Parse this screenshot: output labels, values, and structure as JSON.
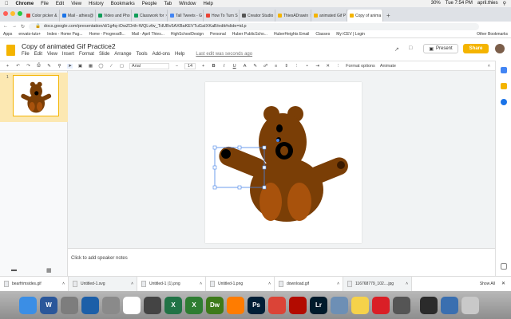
{
  "mac_menu": {
    "app": "Chrome",
    "items": [
      "File",
      "Edit",
      "View",
      "History",
      "Bookmarks",
      "People",
      "Tab",
      "Window",
      "Help"
    ],
    "battery": "30%",
    "clock": "Tue 7:54 PM",
    "user": "april.thies"
  },
  "tabs": [
    {
      "label": "Color picker & ",
      "color": "#ea4335"
    },
    {
      "label": "Mail - athies@",
      "color": "#1a73e8"
    },
    {
      "label": "Video and Pho",
      "color": "#0f9d58"
    },
    {
      "label": "Classwork for",
      "color": "#0f9d58"
    },
    {
      "label": "Tall Tweets - G",
      "color": "#4285f4"
    },
    {
      "label": "How To Turn S",
      "color": "#ea4335"
    },
    {
      "label": "Creator Studio",
      "color": "#555555"
    },
    {
      "label": "ThiesADrawin",
      "color": "#f4b400"
    },
    {
      "label": "animated Gif P",
      "color": "#f4b400"
    },
    {
      "label": "Copy of anima",
      "color": "#f4b400",
      "active": true
    }
  ],
  "address": {
    "url": "docs.google.com/presentation/d/1g4q-iOwZOrth-WQLvfw_TdUBv5AXBaKEVTuGaIXKaB/edit#slide=id.p"
  },
  "bookmarks": [
    "Apps",
    "envato-tuts+",
    "Index - Home Pag...",
    "Home - ProgressB...",
    "Mail - April Thies...",
    "HighSchoolDesign",
    "Personal",
    "Huber PublicScho...",
    "HuberHeights Email",
    "Classes",
    "My iCEV | Login",
    "Other Bookmarks"
  ],
  "docs": {
    "title": "Copy of animated Gif Practice2",
    "menus": [
      "File",
      "Edit",
      "View",
      "Insert",
      "Format",
      "Slide",
      "Arrange",
      "Tools",
      "Add-ons",
      "Help"
    ],
    "last_edit": "Last edit was seconds ago",
    "present_label": "Present",
    "share_label": "Share"
  },
  "toolbar": {
    "font": "Arial",
    "font_size": "14",
    "format_options": "Format options",
    "animate": "Animate"
  },
  "filmstrip": {
    "slide_number": "1"
  },
  "notes": {
    "placeholder": "Click to add speaker notes"
  },
  "downloads": [
    {
      "name": "bearfrimsides.gif"
    },
    {
      "name": "Untitled-1.svg"
    },
    {
      "name": "Untitled-1 (1).png"
    },
    {
      "name": "Untitled-1.png"
    },
    {
      "name": "download.gif"
    },
    {
      "name": "116768779_102....jpg"
    }
  ],
  "downloads_show_all": "Show All",
  "dock": [
    {
      "icon": "finder-icon",
      "color": "#3b8ee5",
      "glyph": ""
    },
    {
      "icon": "word-icon",
      "color": "#2b579a",
      "glyph": "W"
    },
    {
      "icon": "launchpad-icon",
      "color": "#7d7d7d",
      "glyph": ""
    },
    {
      "icon": "quicktime-icon",
      "color": "#1c5fa8",
      "glyph": ""
    },
    {
      "icon": "system-preferences-icon",
      "color": "#8a8a8a",
      "glyph": ""
    },
    {
      "icon": "calendar-icon",
      "color": "#ffffff",
      "glyph": ""
    },
    {
      "icon": "photo-booth-icon",
      "color": "#444444",
      "glyph": ""
    },
    {
      "icon": "excel-icon",
      "color": "#217346",
      "glyph": "X"
    },
    {
      "icon": "dreamweaver-x-icon",
      "color": "#2e7d32",
      "glyph": "X"
    },
    {
      "icon": "dreamweaver-icon",
      "color": "#3d7a1a",
      "glyph": "Dw"
    },
    {
      "icon": "illustrator-icon",
      "color": "#ff7c00",
      "glyph": ""
    },
    {
      "icon": "photoshop-icon",
      "color": "#001e36",
      "glyph": "Ps"
    },
    {
      "icon": "chrome-icon",
      "color": "#db4437",
      "glyph": ""
    },
    {
      "icon": "acrobat-icon",
      "color": "#b30b00",
      "glyph": ""
    },
    {
      "icon": "lightroom-icon",
      "color": "#001a2b",
      "glyph": "Lr"
    },
    {
      "icon": "preview-icon",
      "color": "#6d8fb5",
      "glyph": ""
    },
    {
      "icon": "notes-icon",
      "color": "#f6d24a",
      "glyph": ""
    },
    {
      "icon": "creative-cloud-icon",
      "color": "#da1f26",
      "glyph": ""
    },
    {
      "icon": "photos-icon",
      "color": "#555555",
      "glyph": ""
    },
    {
      "icon": "image-capture-icon",
      "color": "#2b2b2b",
      "glyph": ""
    },
    {
      "icon": "downloads-stack-icon",
      "color": "#3a6fb0",
      "glyph": ""
    },
    {
      "icon": "trash-icon",
      "color": "#c9c9c9",
      "glyph": ""
    }
  ],
  "colors": {
    "bear_body": "#7a3e06",
    "bear_dark": "#5a2a03",
    "bear_paw": "#a8520c",
    "docs_yellow": "#f4b400",
    "selection_blue": "#4a86e8"
  }
}
